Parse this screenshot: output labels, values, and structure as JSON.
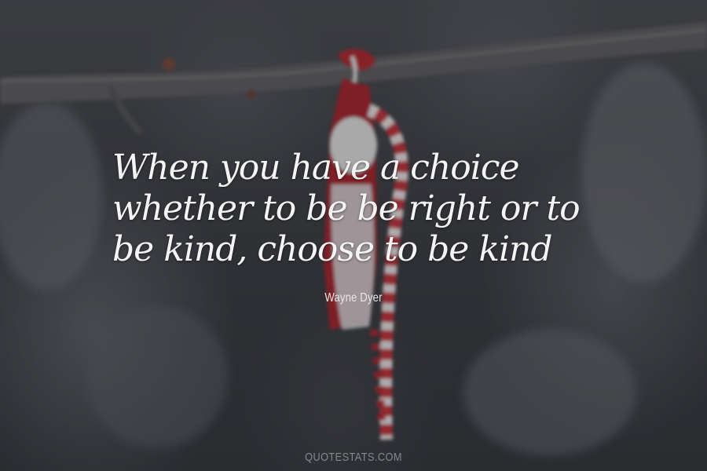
{
  "quote": {
    "text": "When you have a choice whether to be be right or to be kind, choose to be kind",
    "author": "Wayne Dyer"
  },
  "watermark": "QUOTESTATS.COM",
  "colors": {
    "background": "#3b3d42",
    "text": "#f4f4f4",
    "tassel_red": "#b3262f",
    "tassel_white": "#e6e6e6"
  }
}
